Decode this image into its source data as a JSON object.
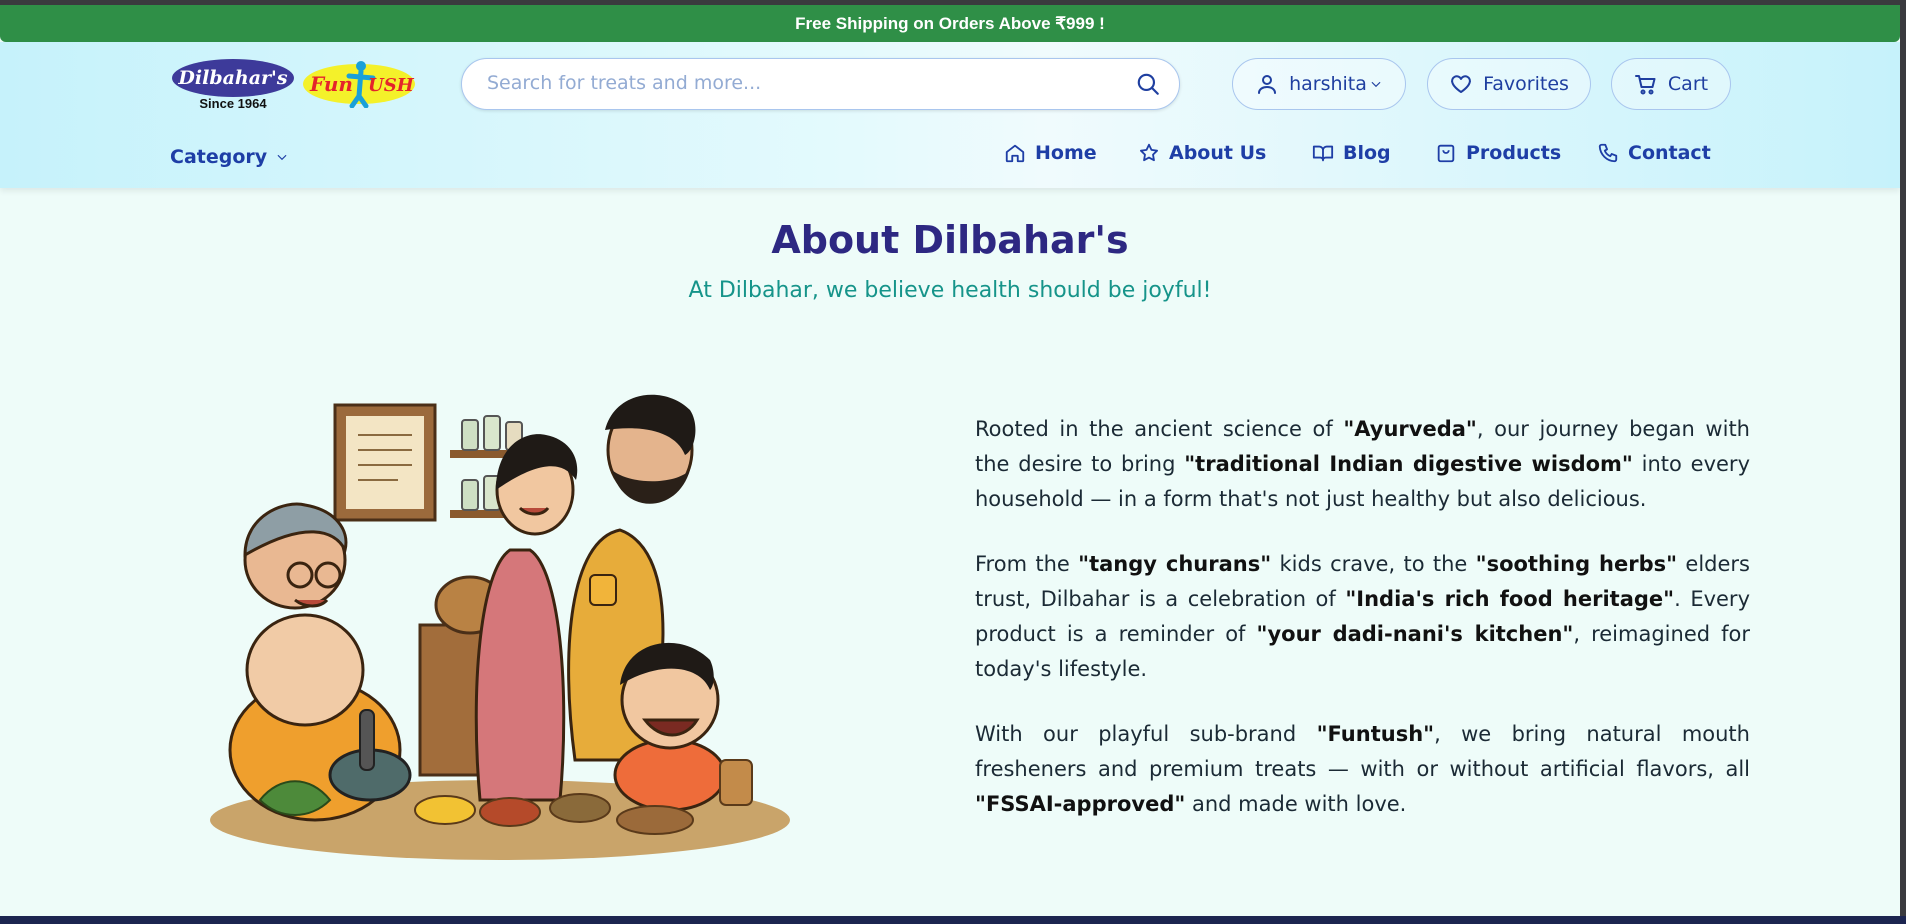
{
  "banner": {
    "text": "Free Shipping on Orders Above ₹999 !"
  },
  "logo": {
    "brand": "Dilbahar's",
    "since": "Since 1964",
    "sub_brand": "FunTush"
  },
  "search": {
    "placeholder": "Search for treats and more..."
  },
  "account": {
    "user": "harshita",
    "favorites": "Favorites",
    "cart": "Cart"
  },
  "nav": {
    "category": "Category",
    "items": [
      {
        "label": "Home",
        "icon": "home-icon"
      },
      {
        "label": "About Us",
        "icon": "star-icon"
      },
      {
        "label": "Blog",
        "icon": "book-icon"
      },
      {
        "label": "Products",
        "icon": "bag-icon"
      },
      {
        "label": "Contact",
        "icon": "phone-icon"
      }
    ]
  },
  "about": {
    "title": "About Dilbahar's",
    "subtitle": "At Dilbahar, we believe health should be joyful!",
    "p1": {
      "a": "Rooted in the ancient science of ",
      "b": "\"Ayurveda\"",
      "c": ", our journey began with the desire to bring ",
      "d": "\"traditional Indian digestive wisdom\"",
      "e": " into every household — in a form that's not just healthy but also delicious."
    },
    "p2": {
      "a": "From the ",
      "b": "\"tangy churans\"",
      "c": " kids crave, to the ",
      "d": "\"soothing herbs\"",
      "e": " elders trust, Dilbahar is a celebration of ",
      "f": "\"India's rich food heritage\"",
      "g": ". Every product is a reminder of ",
      "h": "\"your dadi-nani's kitchen\"",
      "i": ", reimagined for today's lifestyle."
    },
    "p3": {
      "a": "With our playful sub-brand ",
      "b": "\"Funtush\"",
      "c": ", we bring natural mouth fresheners and premium treats — with or without artificial flavors, all ",
      "d": "\"FSSAI-approved\"",
      "e": " and made with love."
    }
  },
  "colors": {
    "banner": "#2f8f47",
    "nav": "#1e3ea6",
    "title": "#2d2882",
    "subtitle": "#16948a"
  }
}
